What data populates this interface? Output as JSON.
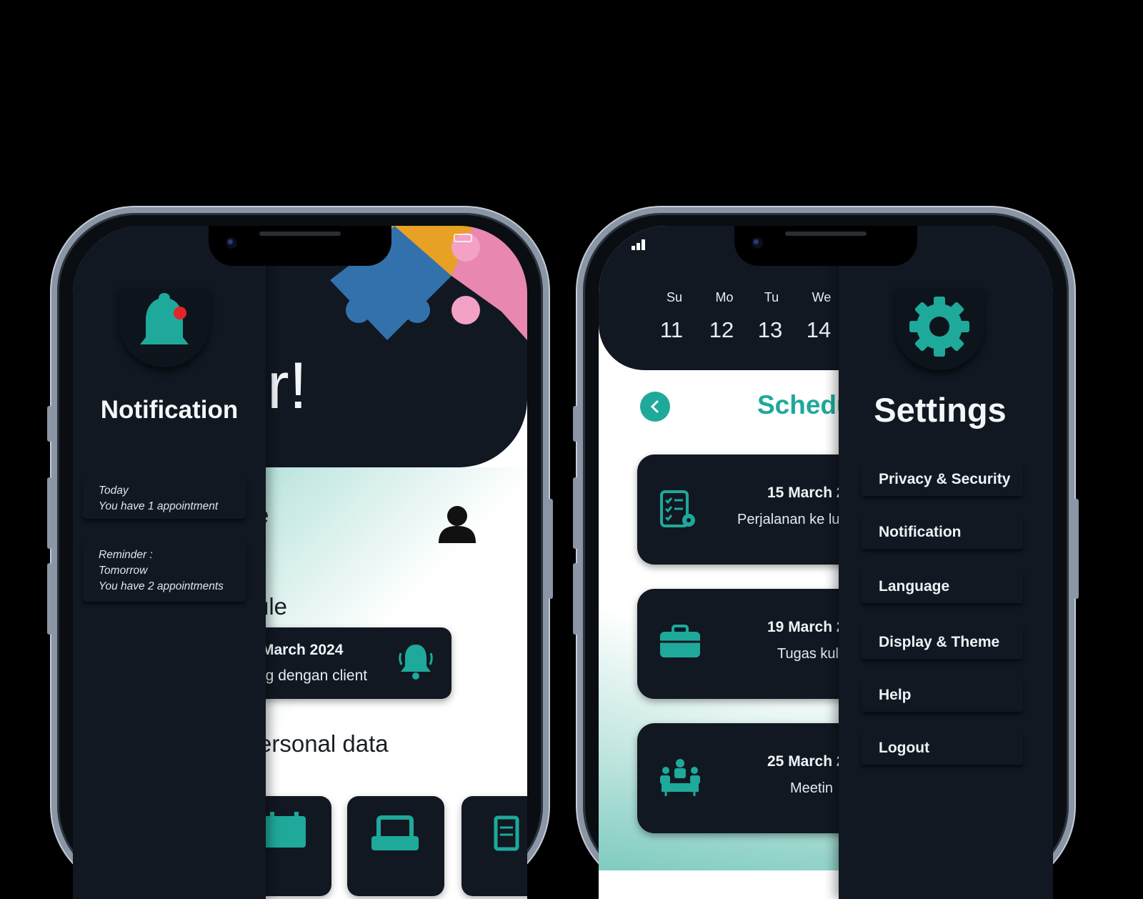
{
  "home": {
    "greeting_fragment": "r!",
    "section_profile_fragment": "e",
    "section_schedule_fragment": "ule",
    "section_personal_fragment": "ersonal data",
    "schedule_card": {
      "date": "March 2024",
      "description": "ng dengan client"
    }
  },
  "notification_drawer": {
    "title": "Notification",
    "cards": [
      {
        "line1": "Today",
        "line2": "You have 1 appointment"
      },
      {
        "line1": "Reminder :",
        "line2": "Tomorrow",
        "line3": "You have 2 appointments"
      }
    ]
  },
  "calendar": {
    "days": [
      {
        "name": "Su",
        "num": "11"
      },
      {
        "name": "Mo",
        "num": "12"
      },
      {
        "name": "Tu",
        "num": "13"
      },
      {
        "name": "We",
        "num": "14"
      }
    ]
  },
  "schedule_page": {
    "title_fragment": "Schedu",
    "items": [
      {
        "date": "15 March 2",
        "desc": "Perjalanan ke lu",
        "icon": "checklist-location-icon"
      },
      {
        "date": "19 March 2",
        "desc": "Tugas kul",
        "icon": "briefcase-icon"
      },
      {
        "date": "25 March 2",
        "desc": "Meetin",
        "icon": "meeting-icon"
      }
    ]
  },
  "settings_drawer": {
    "title": "Settings",
    "items": [
      "Privacy & Security",
      "Notification",
      "Language",
      "Display & Theme",
      "Help",
      "Logout"
    ]
  },
  "colors": {
    "accent": "#1EA99B",
    "surface": "#111822",
    "badge_red": "#E0262B"
  }
}
